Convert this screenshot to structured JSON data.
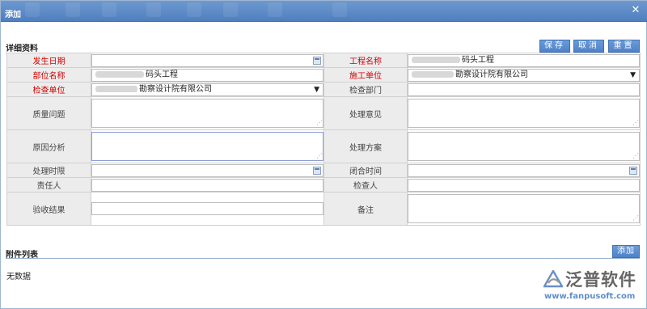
{
  "dialog": {
    "title": "添加",
    "close_icon": "close-icon"
  },
  "details": {
    "section_title": "详细资料",
    "buttons": {
      "save": "保存",
      "cancel": "取消",
      "reset": "重置"
    },
    "fields": {
      "occur_date": {
        "label": "发生日期",
        "value": ""
      },
      "project_name": {
        "label": "工程名称",
        "value": "码头工程"
      },
      "part_name": {
        "label": "部位名称",
        "value": "码头工程"
      },
      "construction_unit": {
        "label": "施工单位",
        "value": "勘察设计院有限公司"
      },
      "inspect_unit": {
        "label": "检查单位",
        "value": "勘察设计院有限公司"
      },
      "inspect_dept": {
        "label": "检查部门",
        "value": ""
      },
      "quality_issue": {
        "label": "质量问题",
        "value": ""
      },
      "handling_opinion": {
        "label": "处理意见",
        "value": ""
      },
      "cause_analysis": {
        "label": "原因分析",
        "value": ""
      },
      "handling_plan": {
        "label": "处理方案",
        "value": ""
      },
      "handling_deadline": {
        "label": "处理时限",
        "value": ""
      },
      "close_time": {
        "label": "闭合时间",
        "value": ""
      },
      "responsible": {
        "label": "责任人",
        "value": ""
      },
      "inspector": {
        "label": "检查人",
        "value": ""
      },
      "acceptance_result": {
        "label": "验收结果",
        "value": ""
      },
      "remarks": {
        "label": "备注",
        "value": ""
      }
    }
  },
  "attachments": {
    "section_title": "附件列表",
    "add_label": "添加",
    "empty_text": "无数据"
  },
  "logo": {
    "name": "泛普软件",
    "url": "www.fanpusoft.com"
  },
  "colors": {
    "titlebar": "#5a88c6",
    "button": "#5b8ccf",
    "required_label": "#d40000",
    "label_bg": "#ececec"
  }
}
